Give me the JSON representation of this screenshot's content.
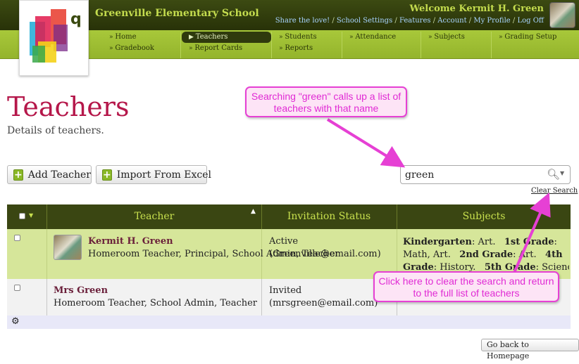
{
  "header": {
    "school_name": "Greenville Elementary School",
    "welcome": "Welcome Kermit H. Green",
    "links": [
      "Share the love!",
      "School Settings",
      "Features",
      "Account",
      "My Profile",
      "Log Off"
    ],
    "logo_letter": "q"
  },
  "nav": {
    "col1": [
      "Home",
      "Gradebook"
    ],
    "col2": [
      "Teachers",
      "Report Cards"
    ],
    "col3": [
      "Students",
      "Reports"
    ],
    "col4": [
      "Attendance"
    ],
    "col5": [
      "Subjects"
    ],
    "col6": [
      "Grading Setup"
    ],
    "active": "Teachers"
  },
  "page": {
    "title": "Teachers",
    "subtitle": "Details of teachers."
  },
  "toolbar": {
    "add_label": "Add Teacher",
    "import_label": "Import From Excel"
  },
  "search": {
    "value": "green",
    "clear_label": "Clear Search"
  },
  "table": {
    "columns": [
      "Teacher",
      "Invitation Status",
      "Subjects"
    ],
    "rows": [
      {
        "name": "Kermit H. Green",
        "roles": "Homeroom Teacher, Principal, School Admin, Teacher",
        "status": "Active",
        "email": "(Greenville@email.com)",
        "subjects_line1_a": "Kindergarten",
        "subjects_line1_b": ": Art.",
        "subjects_line1_c": "1st Grade",
        "subjects_line1_d": ":",
        "subjects_line2_a": "Math, Art.",
        "subjects_line2_b": "2nd Grade",
        "subjects_line2_c": ": Art.",
        "subjects_line2_d": "4th",
        "subjects_line3_a": "Grade",
        "subjects_line3_b": ": History.",
        "subjects_line3_c": "5th Grade",
        "subjects_line3_d": ": Science."
      },
      {
        "name": "Mrs Green",
        "roles": "Homeroom Teacher, School Admin, Teacher",
        "status": "Invited",
        "email": "(mrsgreen@email.com)"
      }
    ]
  },
  "footer": {
    "back_label": "Go back to Homepage"
  },
  "annotations": {
    "search_note": "Searching \"green\" calls up a list of teachers with that name",
    "clear_note": "Click here to clear the search and return to the full list of teachers"
  },
  "colors": {
    "accent": "#b5174a",
    "nav_green": "#a8c83a",
    "header_dark": "#2f3a0d",
    "annotation": "#e02ad4"
  }
}
